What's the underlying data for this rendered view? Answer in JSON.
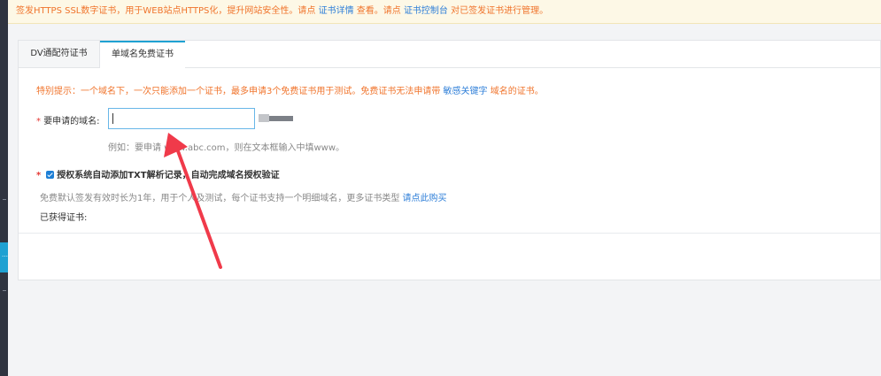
{
  "notice": {
    "text_1": "签发HTTPS SSL数字证书，用于WEB站点HTTPS化，提升网站安全性。请点 ",
    "link_detail": "证书详情",
    "text_2": " 查看。请点 ",
    "link_console": "证书控制台",
    "text_3": " 对已签发证书进行管理。"
  },
  "tabs": [
    {
      "label": "DV通配符证书"
    },
    {
      "label": "单域名免费证书"
    }
  ],
  "tip": {
    "text_1": "特别提示：一个域名下，一次只能添加一个证书，最多申请3个免费证书用于测试。免费证书无法申请带 ",
    "link": "敏感关键字",
    "text_2": " 域名的证书。"
  },
  "domain": {
    "required_mark": "*",
    "label": "要申请的域名:",
    "value": "",
    "example": "例如：要申请 www.abc.com，则在文本框输入中填www。"
  },
  "auth": {
    "required_mark": "*",
    "label": "授权系统自动添加TXT解析记录，自动完成域名授权验证",
    "checked": true
  },
  "free_info": {
    "text": "免费默认签发有效时长为1年，用于个人及测试，每个证书支持一个明细域名，更多证书类型 ",
    "link": "请点此购买"
  },
  "obtained_label": "已获得证书:",
  "sidebar": {
    "active_glyph": "…"
  },
  "colors": {
    "accent": "#1fa1d2",
    "warning": "#f0742c",
    "link": "#2f7fd8",
    "arrow": "#f03a4a"
  }
}
